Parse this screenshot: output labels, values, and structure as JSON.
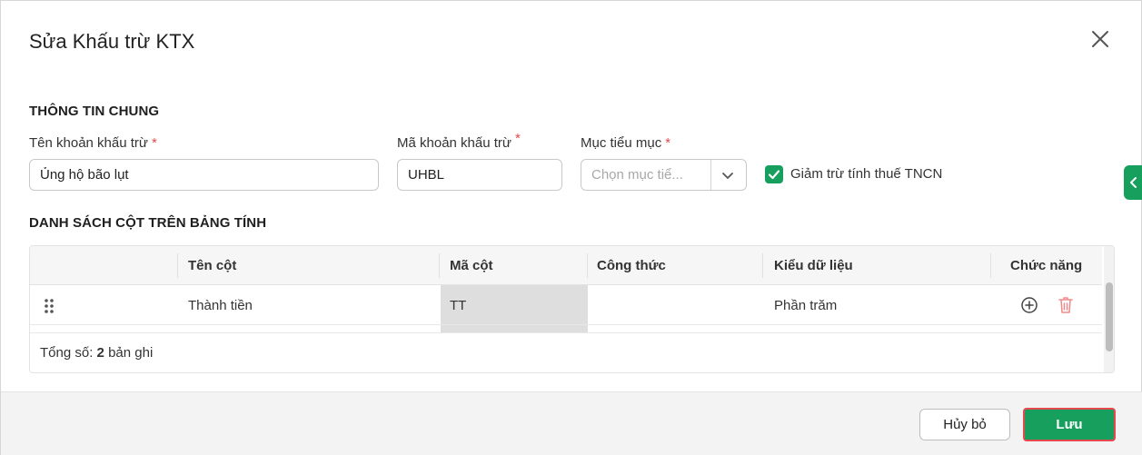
{
  "dialog": {
    "title": "Sửa Khấu trừ KTX"
  },
  "general": {
    "section_title": "THÔNG TIN CHUNG",
    "name_label": "Tên khoản khấu trừ",
    "name_value": "Ủng hộ bão lụt",
    "code_label": "Mã khoản khấu trừ",
    "code_value": "UHBL",
    "item_label": "Mục tiểu mục",
    "item_placeholder": "Chọn mục tiể...",
    "required_mark": "*",
    "tax_checkbox_label": "Giảm trừ tính thuế TNCN",
    "tax_checkbox_checked": true
  },
  "columns": {
    "section_title": "DANH SÁCH CỘT TRÊN BẢNG TÍNH",
    "headers": [
      "Tên cột",
      "Mã cột",
      "Công thức",
      "Kiểu dữ liệu",
      "Chức năng"
    ],
    "rows": [
      {
        "name": "Thành tiền",
        "code": "TT",
        "formula": "",
        "data_type": "Phần trăm"
      }
    ],
    "total_label": "Tổng số:",
    "total_count": "2",
    "total_suffix": "bản ghi"
  },
  "footer": {
    "cancel_label": "Hủy bỏ",
    "save_label": "Lưu"
  },
  "colors": {
    "accent": "#17a05d",
    "required": "#e5484d",
    "delete_icon": "#f08a8a"
  },
  "icons": [
    "close-icon",
    "chevron-down-icon",
    "check-icon",
    "chevron-left-icon",
    "drag-handle-icon",
    "add-circle-icon",
    "trash-icon"
  ]
}
